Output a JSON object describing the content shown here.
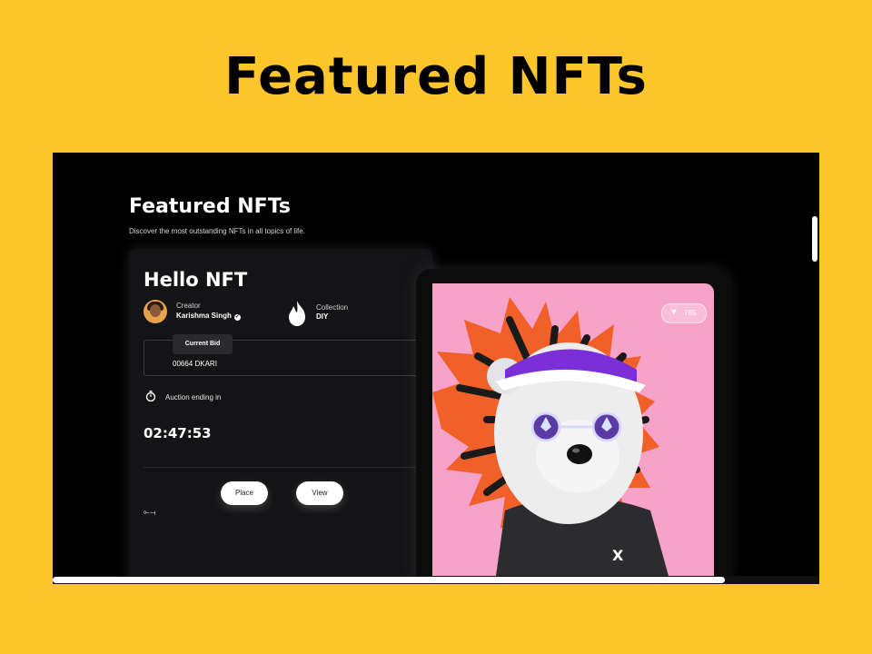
{
  "slide": {
    "title": "Featured NFTs"
  },
  "page": {
    "heading": "Featured NFTs",
    "subheading": "Discover the most outstanding NFTs in all topics of life."
  },
  "card": {
    "title": "Hello NFT",
    "creator_label": "Creator",
    "creator_name": "Karishma Singh",
    "collection_label": "Collection",
    "collection_value": "DIY",
    "current_bid_label": "Current Bid",
    "current_bid_value": "00664 DKARI",
    "auction_label": "Auction ending in",
    "countdown": "02:47:53",
    "place_button": "Place",
    "view_button": "View",
    "share_glyph": "⟜⟞"
  },
  "artwork": {
    "likes": "765",
    "shirt_mark": "X",
    "background_color": "#F7A3C9"
  },
  "icons": [
    "verified-icon",
    "flame-icon",
    "timer-icon",
    "heart-icon",
    "share-icon"
  ]
}
